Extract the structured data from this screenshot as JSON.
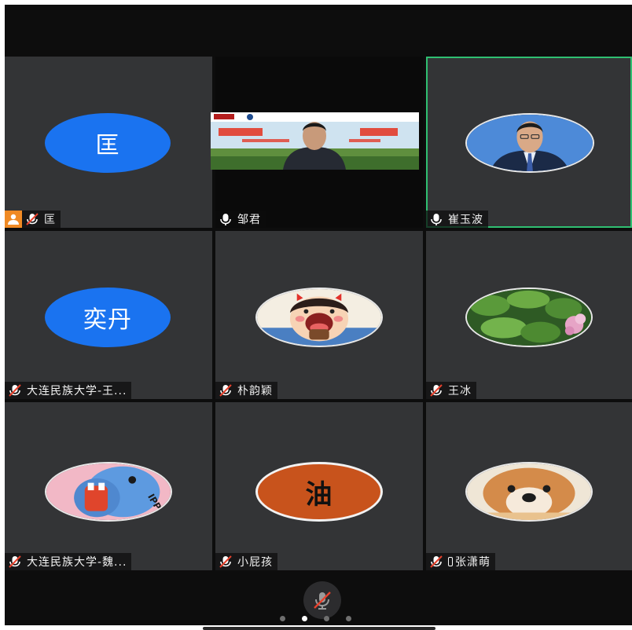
{
  "participants": [
    {
      "name": "匡",
      "avatar_text": "匡",
      "avatar_color": "#1a73f0",
      "host": true,
      "muted": true,
      "icon": "user-host-icon"
    },
    {
      "name": "邹君",
      "video": true,
      "muted": false
    },
    {
      "name": "崔玉波",
      "avatar_icon": "man-portrait-avatar",
      "muted": false,
      "active_speaker": true
    },
    {
      "name": "大连民族大学-王...",
      "avatar_text": "奕丹",
      "avatar_color": "#1a73f0",
      "muted": true
    },
    {
      "name": "朴韵颖",
      "avatar_icon": "cartoon-girl-avatar",
      "muted": true
    },
    {
      "name": "王冰",
      "avatar_icon": "green-leaves-avatar",
      "muted": true
    },
    {
      "name": "大连民族大学-魏...",
      "avatar_icon": "hippo-cartoon-avatar",
      "muted": true
    },
    {
      "name": "小屁孩",
      "avatar_text": "油",
      "avatar_color": "#c8531c",
      "muted": true
    },
    {
      "name": "张潇萌",
      "avatar_icon": "shiba-dog-avatar",
      "muted": true
    }
  ],
  "controls": {
    "mute_button_icon": "mic-muted-icon",
    "page_dots": 4,
    "current_page": 2
  },
  "colors": {
    "tile_bg": "#333436",
    "active_border": "#2fbf71",
    "host_badge": "#f08a24",
    "muted_red": "#e8412c"
  }
}
